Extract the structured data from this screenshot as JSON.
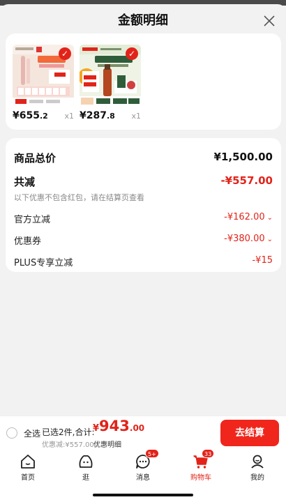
{
  "sheet": {
    "title": "金额明细",
    "close_icon": "close-icon"
  },
  "products": [
    {
      "price_int": "¥655",
      "price_dec": ".2",
      "qty": "x1",
      "image": "cosmetics-set-pink"
    },
    {
      "price_int": "¥287",
      "price_dec": ".8",
      "qty": "x1",
      "image": "skincare-set-green"
    }
  ],
  "summary": {
    "goods_total_label": "商品总价",
    "goods_total_value": "¥1,500.00",
    "reduce_label": "共减",
    "reduce_value": "-¥557.00",
    "reduce_note": "以下优惠不包含红包，请在结算页查看",
    "official_label": "官方立减",
    "official_value": "-¥162.00",
    "coupon_label": "优惠券",
    "coupon_value": "-¥380.00",
    "plus_label": "PLUS专享立减",
    "plus_value": "-¥15"
  },
  "bottom": {
    "select_all": "全选",
    "selected_text": "已选2件,合计:",
    "total_sym": "¥",
    "total_int": "943",
    "total_dec": ".00",
    "discount_text": "优惠减:¥557.00",
    "detail_link": "优惠明细",
    "checkout": "去结算"
  },
  "tabs": [
    {
      "label": "首页",
      "icon": "home-icon"
    },
    {
      "label": "逛",
      "icon": "browse-face-icon"
    },
    {
      "label": "消息",
      "icon": "message-icon",
      "badge": "5+"
    },
    {
      "label": "购物车",
      "icon": "cart-icon",
      "badge": "33"
    },
    {
      "label": "我的",
      "icon": "profile-icon"
    }
  ],
  "colors": {
    "accent": "#e2231a",
    "checkout_bg": "#f0251c",
    "background": "#f2f2f2"
  }
}
